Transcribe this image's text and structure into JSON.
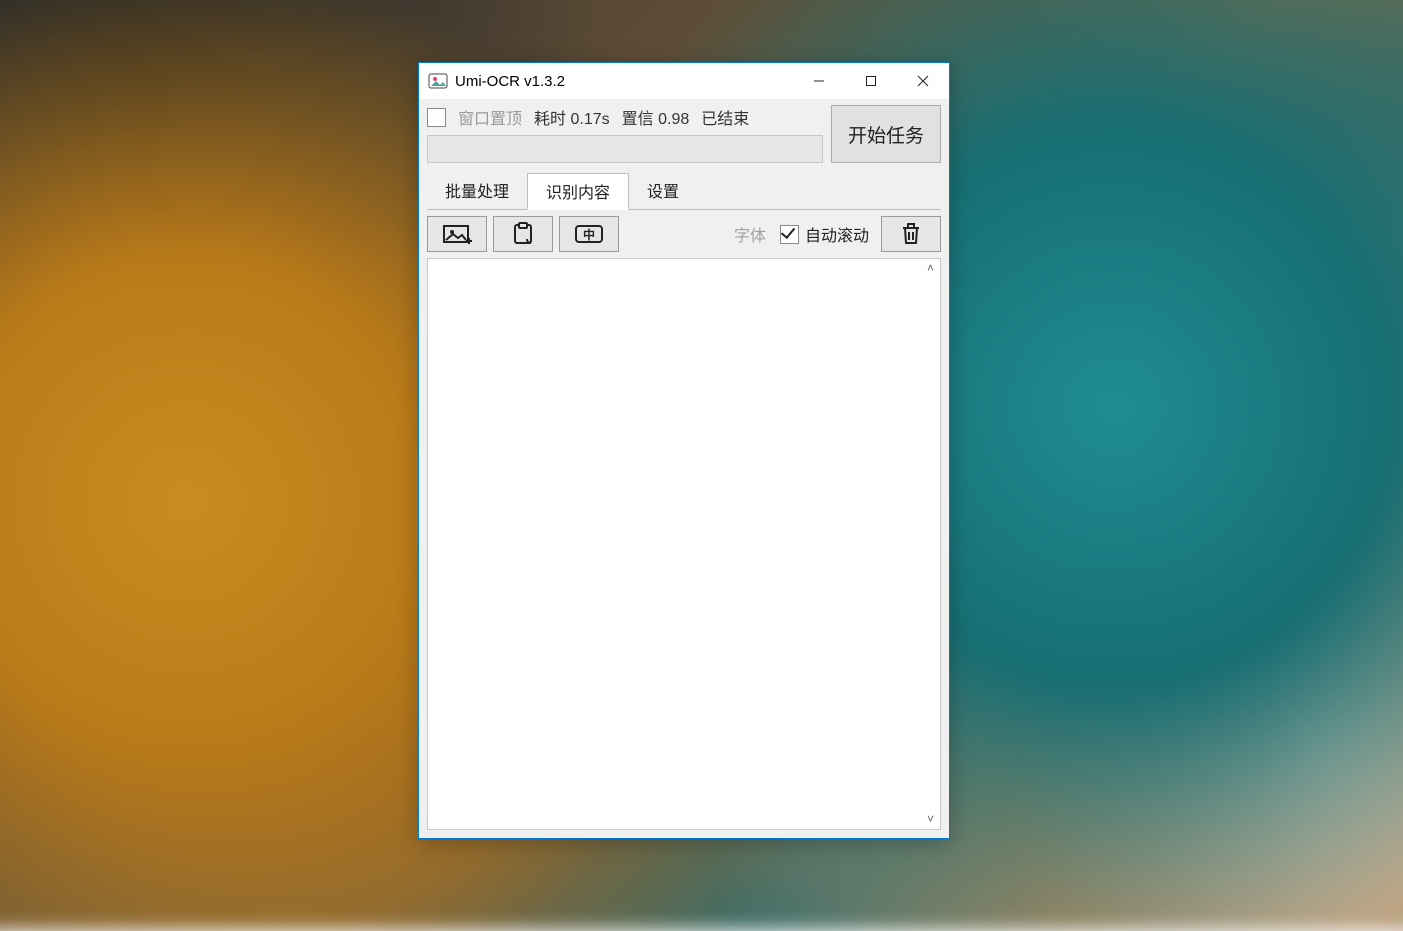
{
  "window": {
    "title": "Umi-OCR v1.3.2"
  },
  "status": {
    "pin_label": "窗口置顶",
    "time_label": "耗时",
    "time_value": "0.17s",
    "confidence_label": "置信",
    "confidence_value": "0.98",
    "state": "已结束"
  },
  "buttons": {
    "start": "开始任务"
  },
  "tabs": {
    "batch": "批量处理",
    "recognize": "识别内容",
    "settings": "设置"
  },
  "toolbar": {
    "font_label": "字体",
    "auto_scroll_label": "自动滚动",
    "auto_scroll_checked": true
  }
}
